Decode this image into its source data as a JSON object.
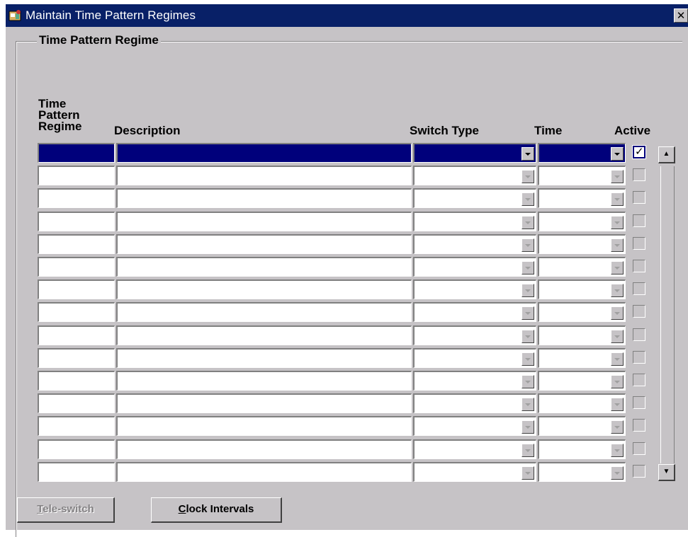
{
  "window": {
    "title": "Maintain Time Pattern Regimes",
    "close_glyph": "✕"
  },
  "group": {
    "title": "Time Pattern Regime"
  },
  "columns": {
    "regime": [
      "Time",
      "Pattern",
      "Regime"
    ],
    "description": "Description",
    "switch_type": "Switch Type",
    "time": "Time",
    "active": "Active"
  },
  "rows": [
    {
      "regime": "",
      "description": "",
      "switch_type": "",
      "time": "",
      "active": true,
      "selected": true
    },
    {
      "regime": "",
      "description": "",
      "switch_type": "",
      "time": "",
      "active": false
    },
    {
      "regime": "",
      "description": "",
      "switch_type": "",
      "time": "",
      "active": false
    },
    {
      "regime": "",
      "description": "",
      "switch_type": "",
      "time": "",
      "active": false
    },
    {
      "regime": "",
      "description": "",
      "switch_type": "",
      "time": "",
      "active": false
    },
    {
      "regime": "",
      "description": "",
      "switch_type": "",
      "time": "",
      "active": false
    },
    {
      "regime": "",
      "description": "",
      "switch_type": "",
      "time": "",
      "active": false
    },
    {
      "regime": "",
      "description": "",
      "switch_type": "",
      "time": "",
      "active": false
    },
    {
      "regime": "",
      "description": "",
      "switch_type": "",
      "time": "",
      "active": false
    },
    {
      "regime": "",
      "description": "",
      "switch_type": "",
      "time": "",
      "active": false
    },
    {
      "regime": "",
      "description": "",
      "switch_type": "",
      "time": "",
      "active": false
    },
    {
      "regime": "",
      "description": "",
      "switch_type": "",
      "time": "",
      "active": false
    },
    {
      "regime": "",
      "description": "",
      "switch_type": "",
      "time": "",
      "active": false
    },
    {
      "regime": "",
      "description": "",
      "switch_type": "",
      "time": "",
      "active": false
    },
    {
      "regime": "",
      "description": "",
      "switch_type": "",
      "time": "",
      "active": false
    }
  ],
  "buttons": {
    "teleswitch": {
      "label_first": "T",
      "label_rest": "ele-switch",
      "enabled": false
    },
    "clock_intervals": {
      "label_first": "C",
      "label_rest": "lock Intervals",
      "enabled": true
    }
  },
  "icons": {
    "app": "window-app-icon",
    "dropdown": "chevron-down-icon",
    "scroll_up": "scroll-up-arrow-icon",
    "scroll_down": "scroll-down-arrow-icon"
  },
  "colors": {
    "titlebar": "#082067",
    "selection": "#00007b",
    "face": "#c6c3c6"
  }
}
